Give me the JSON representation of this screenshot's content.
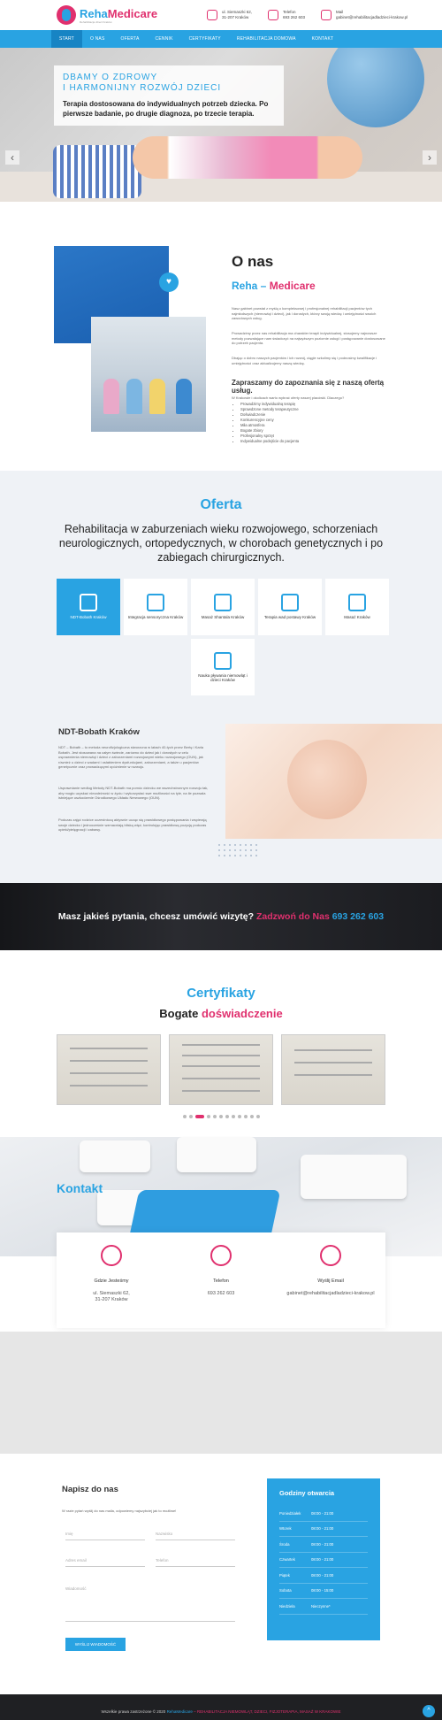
{
  "header": {
    "logo_text_main": "Reha",
    "logo_text_accent": "Medicare",
    "logo_tagline": "Rehabilitacja dzieci Kraków",
    "address": {
      "line1": "ul. Siemaszki 62,",
      "line2": "31-207 Kraków"
    },
    "phone": {
      "label": "Telefon",
      "value": "693 262 603"
    },
    "email": {
      "label": "Mail",
      "value": "gabinet@rehabilitacjadladzieci-krakow.pl"
    }
  },
  "nav": {
    "items": [
      "Start",
      "O nas",
      "Oferta",
      "Cennik",
      "Certyfikaty",
      "Rehabilitacja domowa",
      "Kontakt"
    ]
  },
  "hero": {
    "kicker_line1": "DBAMY O ZDROWY",
    "kicker_line2": "I HARMONIJNY ROZWÓJ DZIECI",
    "lead": "Terapia dostosowana do indywidualnych potrzeb dziecka. Po pierwsze badanie, po drugie diagnoza, po trzecie terapia.",
    "prev": "‹",
    "next": "›"
  },
  "onas": {
    "title": "O nas",
    "subtitle_main": "Reha –",
    "subtitle_accent": "Medicare",
    "p1": "Nasz gabinet powstał z myślą o kompleksowej i profesjonalnej rehabilitacji pacjentów tych najmłodszych (niemowląt i dzieci), jak i dorosłych, którzy swoją wiedzę i umiejętności swoich zawodowych usług.",
    "p2": "Prowadzimy przez nas rehabilitacja ma charakter terapii indywidualnej, stosujemy najnowsze metody pozwalające nam świadczyć na najwyższym poziomie usługi i postępowanie dostosowane do potrzeb pacjenta.",
    "p3": "Dbając o dobro naszych pacjentów i ich rozwój, ciągle szkolimy się i podnosimy kwalifikacje i umiejętności oraz aktualizujemy naszą wiedzę.",
    "h2": "Zapraszamy do zapoznania się z naszą ofertą usług.",
    "list_intro": "W Krakowie i okolicach warto wybrać oferty naszej placówki. Dlaczego?",
    "list": [
      "Prowadzimy indywidualną terapię",
      "Sprawdzone metody terapeutyczne",
      "Doświadczenie",
      "Konkurencyjne ceny",
      "Miła atmosfera",
      "Bogate zbiory",
      "Profesjonalny sprzęt",
      "Indywidualne podejście do pacjenta"
    ],
    "heart_icon": "heart-icon"
  },
  "oferta": {
    "title": "Oferta",
    "lead": "Rehabilitacja w zaburzeniach wieku rozwojowego, schorzeniach neurologicznych, ortopedycznych, w chorobach genetycznych i po zabiegach chirurgicznych.",
    "cards": [
      "NDT-Bobath Kraków",
      "Integracja sensoryczna Kraków",
      "Masaż Shantala Kraków",
      "Terapia wad postawy Kraków",
      "Masaż Kraków",
      "Nauka pływania niemowląt i dzieci Kraków"
    ],
    "ndt_title": "NDT-Bobath Kraków",
    "ndt_p1": "NDT – Bobath – to metoda neurofizjologiczna stworzona w latach 40-tych przez Bertę i Karla Bobath. Jest stosowana na całym świecie, zarówno do dzieci jak i dorosłych w celu usprawnienia niemowląt i dzieci z zaburzeniami rozwojowymi wieku rozwojowego (OUN), jak również u dzieci z wadami i osłabieniem dysfunkcjami, zaburzeniami, a także u pacjentów genetycznie oraz prowadzącymi opóźnienie w rozwoju.",
    "ndt_p2": "Usprawnianie według Metody NDT-Bobath ma pomóc dziecku we wszechstronnym rozwoju tak, aby mogło uzyskać niezależność w życiu i wykorzystać swe możliwości na tyle, na ile pozwala istniejące uszkodzenie Ośrodkowego Układu Nerwowego (OUN).",
    "ndt_p3": "Podczas zajęć rodzice uczestniczą aktywnie ucząc się prawidłowego postępowania i wspierają swoje dziecko i jednocześnie wzmacniają bliską więź, kontrolując prawidłową pozycję podczas opieki/pielęgnacji i zabawy."
  },
  "cta": {
    "text": "Masz jakieś pytania, chcesz umówić wizytę?",
    "pink": "Zadzwoń do Nas",
    "phone": "693 262 603"
  },
  "cert": {
    "title": "Certyfikaty",
    "sub_main": "Bogate",
    "sub_accent": "doświadczenie",
    "items": [
      "Certyfikat 1",
      "Certyfikat 2",
      "Certyfikat 3"
    ],
    "dots": 12,
    "active_dot": 2
  },
  "kontakt": {
    "title": "Kontakt",
    "cards": [
      {
        "label": "Gdzie Jesteśmy",
        "value": "ul. Siemaszki 62,\n31-207 Kraków",
        "icon": "location-icon"
      },
      {
        "label": "Telefon",
        "value": "693 262 603",
        "icon": "phone-icon"
      },
      {
        "label": "Wyślij Email",
        "value": "gabinet@rehabilitacjadladzieci-krakow.pl",
        "icon": "mail-icon"
      }
    ]
  },
  "form": {
    "title": "Napisz do nas",
    "note": "W razie pytań wyślij do nas maila, odpowiemy najszybciej jak to możliwe!",
    "placeholders": {
      "name": "Imię",
      "surname": "Nazwisko",
      "email": "Adres email",
      "phone": "Telefon",
      "message": "Wiadomość"
    },
    "button": "WYŚLIJ WIADOMOŚĆ"
  },
  "hours": {
    "title": "Godziny otwarcia",
    "rows": [
      {
        "day": "Poniedziałek",
        "time": "08:00 - 21:00"
      },
      {
        "day": "Wtorek",
        "time": "08:00 - 21:00"
      },
      {
        "day": "Środa",
        "time": "08:00 - 21:00"
      },
      {
        "day": "Czwartek",
        "time": "08:00 - 21:00"
      },
      {
        "day": "Piątek",
        "time": "08:00 - 21:00"
      },
      {
        "day": "Sobota",
        "time": "08:00 - 15:00"
      },
      {
        "day": "Niedziela",
        "time": "Nieczynne*"
      }
    ]
  },
  "footer": {
    "copy": "Wszelkie prawa zastrzeżone © 2020",
    "brand": "RehaMedicare",
    "links": "– REHABILITACJA NIEMOWLĄT, DZIECI, FIZJOTERAPIA, MASAŻ W KRAKOWIE",
    "totop": "^"
  },
  "colors": {
    "blue": "#29a3e2",
    "pink": "#e0306e",
    "dark": "#1f2023"
  }
}
